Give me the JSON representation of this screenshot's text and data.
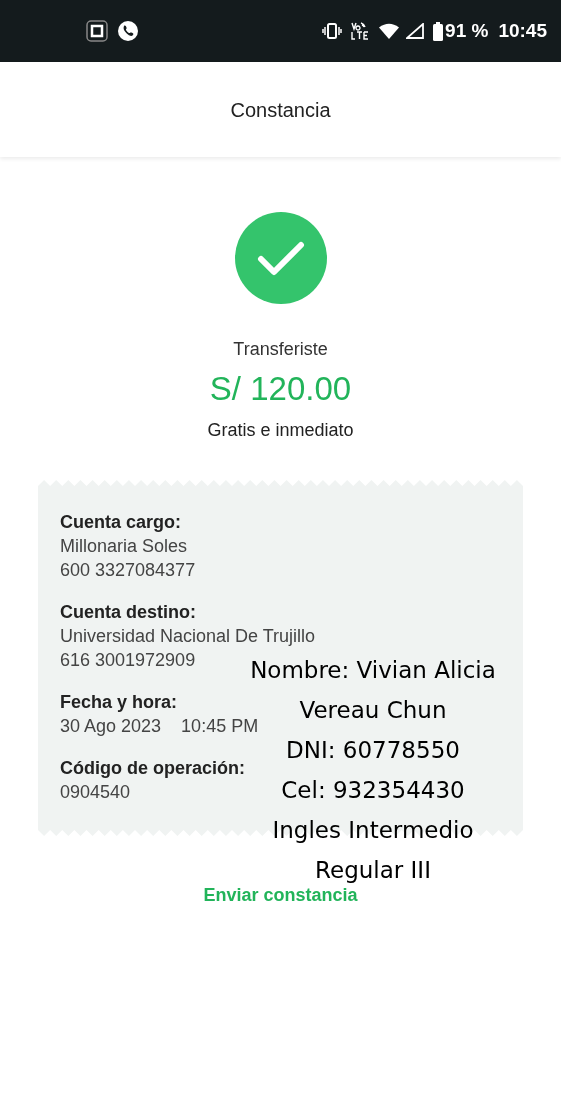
{
  "status_bar": {
    "battery": "91 %",
    "time": "10:45"
  },
  "header": {
    "title": "Constancia"
  },
  "result": {
    "label": "Transferiste",
    "amount": "S/ 120.00",
    "note": "Gratis e inmediato"
  },
  "receipt": {
    "fields": [
      {
        "label": "Cuenta cargo:",
        "lines": [
          "Millonaria Soles",
          "600 3327084377"
        ]
      },
      {
        "label": "Cuenta destino:",
        "lines": [
          "Universidad Nacional De Trujillo",
          "616 3001972909"
        ]
      },
      {
        "label": "Fecha y hora:",
        "lines": [
          "30 Ago 2023    10:45 PM"
        ]
      },
      {
        "label": "Código de operación:",
        "lines": [
          "0904540"
        ]
      }
    ]
  },
  "overlay_note": [
    "Nombre: Vivian Alicia",
    "Vereau Chun",
    "DNI: 60778550",
    "Cel: 932354430",
    "Ingles Intermedio",
    "Regular III"
  ],
  "send_link": "Enviar constancia"
}
